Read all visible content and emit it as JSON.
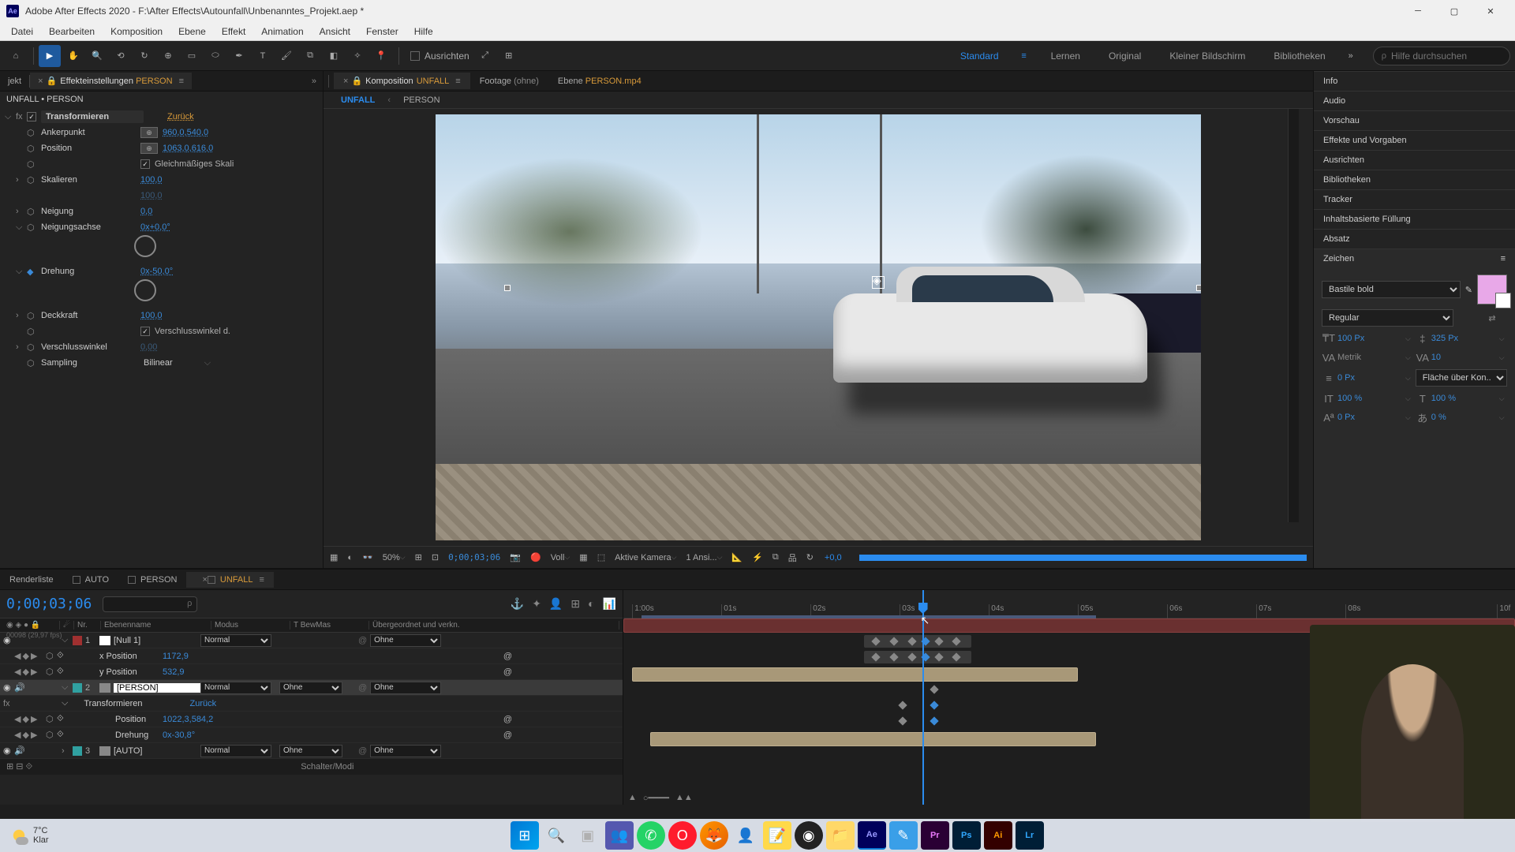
{
  "window": {
    "title": "Adobe After Effects 2020 - F:\\After Effects\\Autounfall\\Unbenanntes_Projekt.aep *"
  },
  "menu": [
    "Datei",
    "Bearbeiten",
    "Komposition",
    "Ebene",
    "Effekt",
    "Animation",
    "Ansicht",
    "Fenster",
    "Hilfe"
  ],
  "toolbar": {
    "align": "Ausrichten",
    "workspaces": [
      "Standard",
      "Lernen",
      "Original",
      "Kleiner Bildschirm",
      "Bibliotheken"
    ],
    "search_placeholder": "Hilfe durchsuchen"
  },
  "left": {
    "tabs": {
      "project": "jekt",
      "effect": "Effekteinstellungen",
      "effect_target": "PERSON"
    },
    "breadcrumb": "UNFALL • PERSON",
    "fx": {
      "name": "Transformieren",
      "reset": "Zurück",
      "anchor": {
        "label": "Ankerpunkt",
        "value": "960,0,540,0"
      },
      "position": {
        "label": "Position",
        "value": "1063,0,616,0"
      },
      "uniform": "Gleichmäßiges Skali",
      "scale": {
        "label": "Skalieren",
        "value": "100,0",
        "value2": "100,0"
      },
      "skew": {
        "label": "Neigung",
        "value": "0,0"
      },
      "skew_axis": {
        "label": "Neigungsachse",
        "value": "0x+0,0°"
      },
      "rotation": {
        "label": "Drehung",
        "value": "0x-50,0°"
      },
      "opacity": {
        "label": "Deckkraft",
        "value": "100,0"
      },
      "shutter_use": "Verschlusswinkel d.",
      "shutter": {
        "label": "Verschlusswinkel",
        "value": "0,00"
      },
      "sampling": {
        "label": "Sampling",
        "value": "Bilinear"
      }
    }
  },
  "comp": {
    "tabs": {
      "comp_label": "Komposition",
      "comp_name": "UNFALL",
      "footage_label": "Footage",
      "footage_name": "(ohne)",
      "layer_label": "Ebene",
      "layer_name": "PERSON.mp4"
    },
    "nested": {
      "active": "UNFALL",
      "link": "PERSON"
    },
    "footer": {
      "zoom": "50%",
      "timecode": "0;00;03;06",
      "res": "Voll",
      "camera": "Aktive Kamera",
      "views": "1 Ansi...",
      "exposure": "+0,0"
    }
  },
  "right": {
    "sections": [
      "Info",
      "Audio",
      "Vorschau",
      "Effekte und Vorgaben",
      "Ausrichten",
      "Bibliotheken",
      "Tracker",
      "Inhaltsbasierte Füllung",
      "Absatz"
    ],
    "char": {
      "title": "Zeichen",
      "font": "Bastile bold",
      "style": "Regular",
      "size": "100 Px",
      "leading": "325 Px",
      "kerning": "Metrik",
      "tracking": "10",
      "stroke": "0 Px",
      "stroke_label": "Fläche über Kon...",
      "vscale": "100 %",
      "hscale": "100 %",
      "baseline": "0 Px",
      "tsume": "0 %"
    }
  },
  "timeline": {
    "tabs": [
      "Renderliste",
      "AUTO",
      "PERSON",
      "UNFALL"
    ],
    "timecode": "0;00;03;06",
    "timecode_sub": "00098 (29,97 fps)",
    "cols": {
      "num": "Nr.",
      "name": "Ebenenname",
      "mode": "Modus",
      "trk": "T  BewMas",
      "parent": "Übergeordnet und verkn."
    },
    "layers": [
      {
        "num": "1",
        "name": "[Null 1]",
        "mode": "Normal",
        "trk": "",
        "parent": "Ohne",
        "color": "red"
      },
      {
        "num": "2",
        "name": "[PERSON]",
        "mode": "Normal",
        "trk": "Ohne",
        "parent": "Ohne",
        "color": "teal",
        "selected": true
      },
      {
        "num": "3",
        "name": "[AUTO]",
        "mode": "Normal",
        "trk": "Ohne",
        "parent": "Ohne",
        "color": "teal"
      }
    ],
    "props": {
      "xpos": {
        "name": "x Position",
        "value": "1172,9"
      },
      "ypos": {
        "name": "y Position",
        "value": "532,9"
      },
      "transform_group": "Transformieren",
      "transform_reset": "Zurück",
      "pos": {
        "name": "Position",
        "value": "1022,3,584,2"
      },
      "rot": {
        "name": "Drehung",
        "value": "0x-30,8°"
      }
    },
    "ticks": [
      "1:00s",
      "01s",
      "02s",
      "03s",
      "04s",
      "05s",
      "06s",
      "07s",
      "08s",
      "10f"
    ],
    "footer": "Schalter/Modi"
  },
  "taskbar": {
    "temp": "7°C",
    "cond": "Klar"
  }
}
